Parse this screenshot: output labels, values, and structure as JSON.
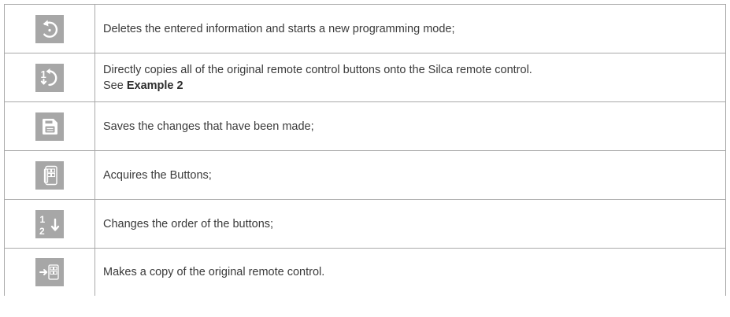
{
  "rows": [
    {
      "icon": "restart-icon",
      "text": "Deletes the entered information and starts a new programming mode;"
    },
    {
      "icon": "direct-copy-icon",
      "text": "Directly copies all of the original remote control buttons onto the Silca remote control.",
      "text_line2_prefix": "See ",
      "text_line2_bold": "Example 2"
    },
    {
      "icon": "save-icon",
      "text": "Saves the changes that have been made;"
    },
    {
      "icon": "acquire-buttons-icon",
      "text": "Acquires the Buttons;"
    },
    {
      "icon": "reorder-icon",
      "text": "Changes the order of the buttons;"
    },
    {
      "icon": "copy-remote-icon",
      "text": "Makes a copy of the original remote control."
    }
  ],
  "colors": {
    "icon_background": "#a7a7a7",
    "icon_glyph": "#ffffff",
    "border": "#a9a9a9",
    "text": "#3a3a3a"
  }
}
